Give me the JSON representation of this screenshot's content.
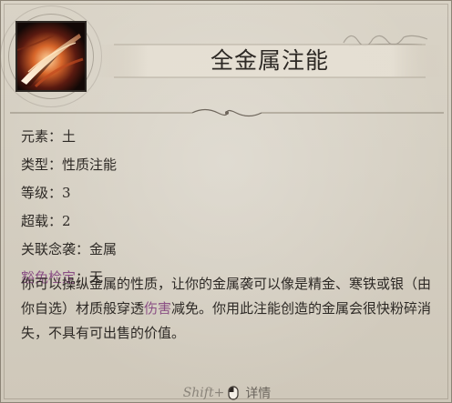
{
  "title": "全金属注能",
  "properties": [
    {
      "label": "元素",
      "value": "土",
      "keyword": false
    },
    {
      "label": "类型",
      "value": "性质注能",
      "keyword": false
    },
    {
      "label": "等级",
      "value": "3",
      "keyword": false
    },
    {
      "label": "超载",
      "value": "2",
      "keyword": false
    },
    {
      "label": "关联念袭",
      "value": "金属",
      "keyword": false
    },
    {
      "label": "豁免检定",
      "value": "无",
      "keyword": true
    }
  ],
  "separator": "：",
  "description": {
    "part1": "你可以操纵金属的性质，让你的金属袭可以像是精金、寒铁或银（由你自选）材质般穿透",
    "keyword": "伤害",
    "part2": "减免。你用此注能创造的金属会很快粉碎消失，不具有可出售的价值。"
  },
  "footer": {
    "shift_key": "Shift+",
    "details_label": "详情"
  },
  "icons": {
    "ability_icon": "metal-blade-icon",
    "footer_mouse": "mouse-icon"
  },
  "colors": {
    "keyword": "#8a4f84",
    "parchment": "#d5cfc2",
    "text": "#2d2925"
  }
}
